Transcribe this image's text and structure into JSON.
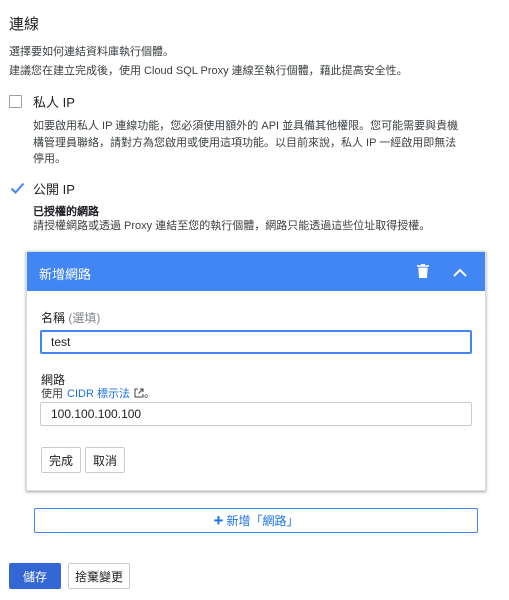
{
  "connection": {
    "title": "連線",
    "desc_line1": "選擇要如何連結資料庫執行個體。",
    "desc_line2": "建議您在建立完成後，使用 Cloud SQL Proxy 連線至執行個體，藉此提高安全性。"
  },
  "private_ip": {
    "label": "私人 IP",
    "checked": false,
    "description": "如要啟用私人 IP 連線功能，您必須使用額外的 API 並具備其他權限。您可能需要與貴機構管理員聯絡，請對方為您啟用或使用這項功能。以目前來說，私人 IP 一經啟用即無法停用。"
  },
  "public_ip": {
    "label": "公開 IP",
    "checked": true
  },
  "authorized_networks": {
    "title": "已授權的網路",
    "description": "請授權網路或透過 Proxy 連結至您的執行個體，網路只能透過這些位址取得授權。"
  },
  "new_network_card": {
    "header_title": "新增網路",
    "icons": {
      "delete": "trash-icon",
      "collapse": "chevron-up-icon"
    },
    "name_label": "名稱",
    "name_optional": "(選填)",
    "name_value": "test",
    "network_label": "網路",
    "network_hint_prefix": "使用",
    "network_hint_link": "CIDR 標示法",
    "network_hint_suffix": "。",
    "network_value": "100.100.100.100",
    "done_label": "完成",
    "cancel_label": "取消"
  },
  "add_network_button": "新增「網路」",
  "footer": {
    "save_label": "儲存",
    "discard_label": "捨棄變更"
  },
  "colors": {
    "accent": "#4285f4",
    "link": "#1a73e8",
    "primary_button": "#3367d6"
  }
}
